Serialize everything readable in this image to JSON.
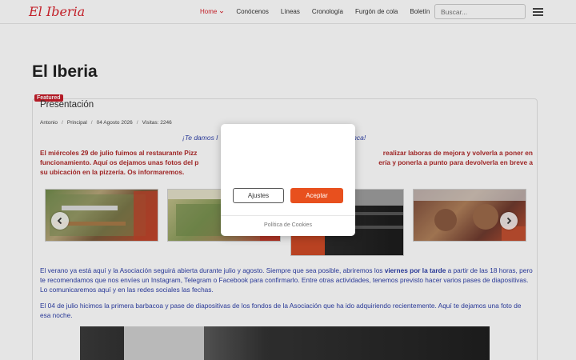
{
  "header": {
    "brand": "El Iberia",
    "nav": [
      {
        "label": "Home",
        "active": true,
        "has_dropdown": true
      },
      {
        "label": "Conócenos"
      },
      {
        "label": "Líneas"
      },
      {
        "label": "Cronología"
      },
      {
        "label": "Furgón de cola"
      },
      {
        "label": "Boletín"
      }
    ],
    "search_placeholder": "Buscar..."
  },
  "page": {
    "title": "El Iberia"
  },
  "article": {
    "badge": "Featured",
    "title": "Presentación",
    "meta": {
      "author": "Antonio",
      "category": "Principal",
      "date": "04 Agosto 2026",
      "visits": "Visitas: 2246",
      "separator": "/"
    },
    "welcome_start": "¡Te damos l",
    "welcome_end": "alamanca!",
    "notice_left": "El miércoles 29 de julio fuimos al restaurante Pizz",
    "notice_right": "realizar laboras de mejora y volverla a poner en",
    "notice_line2_left": "funcionamiento. Aquí os dejamos unas fotos del p",
    "notice_line2_right": "ería y ponerla a punto para devolverla en breve a",
    "notice_line3": "su ubicación en la pizzería. Os informaremos.",
    "para1_before": "El verano ya está aquí y la Asociación seguirá abierta durante julio y agosto. Siempre que sea posible, abriremos los ",
    "para1_bold": "viernes por la tarde",
    "para1_after": " a partir de las 18 horas, pero te recomendamos que nos envíes un Instagram, Telegram o Facebook para confirmarlo. Entre otras actividades, tenemos previsto hacer varios pases de diapositivas. Lo comunicaremos aquí y en las redes sociales las fechas.",
    "para2": "El 04 de julio hicimos la primera barbacoa y pase de diapositivas de los fondos de la Asociación que ha ido adquiriendo recientemente. Aquí te dejamos una foto de esa noche."
  },
  "carousel": {
    "slides": [
      {
        "icon": "layout-photo-1"
      },
      {
        "icon": "layout-photo-2"
      },
      {
        "icon": "layout-photo-3"
      },
      {
        "icon": "layout-photo-4"
      }
    ],
    "prev_icon": "chevron-left-icon",
    "next_icon": "chevron-right-icon"
  },
  "cookie_modal": {
    "settings_label": "Ajustes",
    "accept_label": "Aceptar",
    "policy_link": "Política de Cookies"
  },
  "colors": {
    "brand": "#d9232d",
    "link_blue": "#2c3ea8",
    "notice_red": "#b02a2a",
    "accept": "#e8501e"
  }
}
